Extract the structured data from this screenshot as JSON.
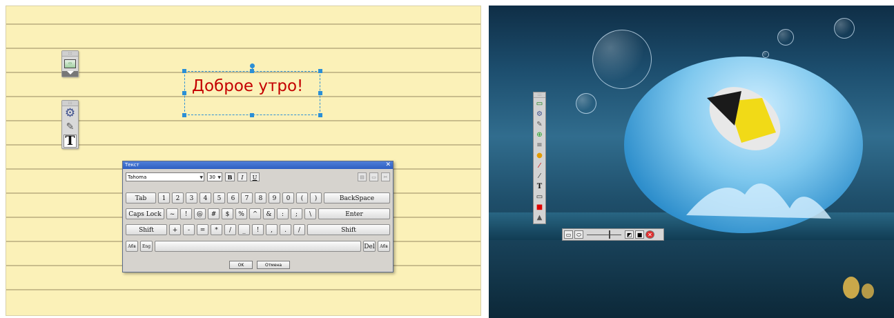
{
  "left_panel": {
    "canvas_text": "Доброе утро!",
    "tool_icons": [
      "monitor-icon",
      "gear-icon",
      "magic-wand-icon",
      "text-tool-icon"
    ],
    "text_tool_glyph": "T"
  },
  "dialog": {
    "title": "Текст",
    "font": "Tahoma",
    "size": "30",
    "bold": "B",
    "italic": "I",
    "underline": "U",
    "rows": [
      [
        "Tab",
        "1",
        "2",
        "3",
        "4",
        "5",
        "6",
        "7",
        "8",
        "9",
        "0",
        "(",
        ")",
        "BackSpace"
      ],
      [
        "Caps Lock",
        "~",
        "!",
        "@",
        "#",
        "$",
        "%",
        "^",
        "&",
        ":",
        ";",
        "\\",
        "Enter"
      ],
      [
        "Shift",
        "+",
        "-",
        "=",
        "*",
        "/",
        "_",
        "!",
        ",",
        ".",
        "/",
        "Shift"
      ]
    ],
    "lang_left": "Абв",
    "lang_eng": "Eng",
    "del": "Del",
    "lang_right": "Абв",
    "ok": "OK",
    "cancel": "Отмена"
  },
  "colors": {
    "text": "#c40000",
    "selection": "#2b8fd6",
    "dialog_title": "#2d5fc2"
  }
}
